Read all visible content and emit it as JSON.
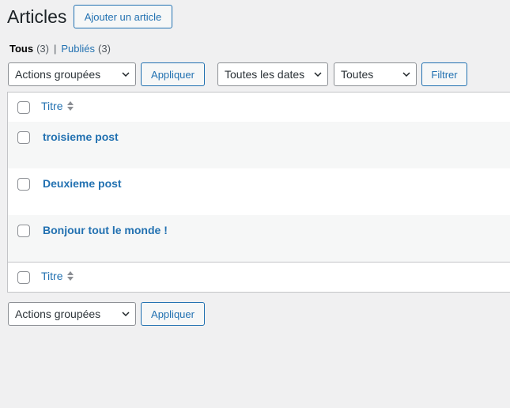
{
  "header": {
    "title": "Articles",
    "add_button": "Ajouter un article"
  },
  "filters": {
    "all": {
      "label": "Tous",
      "count": "(3)"
    },
    "separator": "|",
    "published": {
      "label": "Publiés",
      "count": "(3)"
    }
  },
  "top_actions": {
    "bulk_select": "Actions groupées",
    "apply": "Appliquer",
    "dates_select": "Toutes les dates",
    "category_select": "Toutes",
    "filter_button": "Filtrer"
  },
  "table": {
    "column_title": "Titre",
    "rows": [
      {
        "title": "troisieme post"
      },
      {
        "title": "Deuxieme post"
      },
      {
        "title": "Bonjour tout le monde !"
      }
    ],
    "footer_title": "Titre"
  },
  "bottom_actions": {
    "bulk_select": "Actions groupées",
    "apply": "Appliquer"
  },
  "colors": {
    "accent": "#2271b1",
    "background": "#f0f0f1",
    "row_alt": "#f6f7f7"
  },
  "icons": [
    "chevron-down-icon",
    "sort-icon"
  ]
}
